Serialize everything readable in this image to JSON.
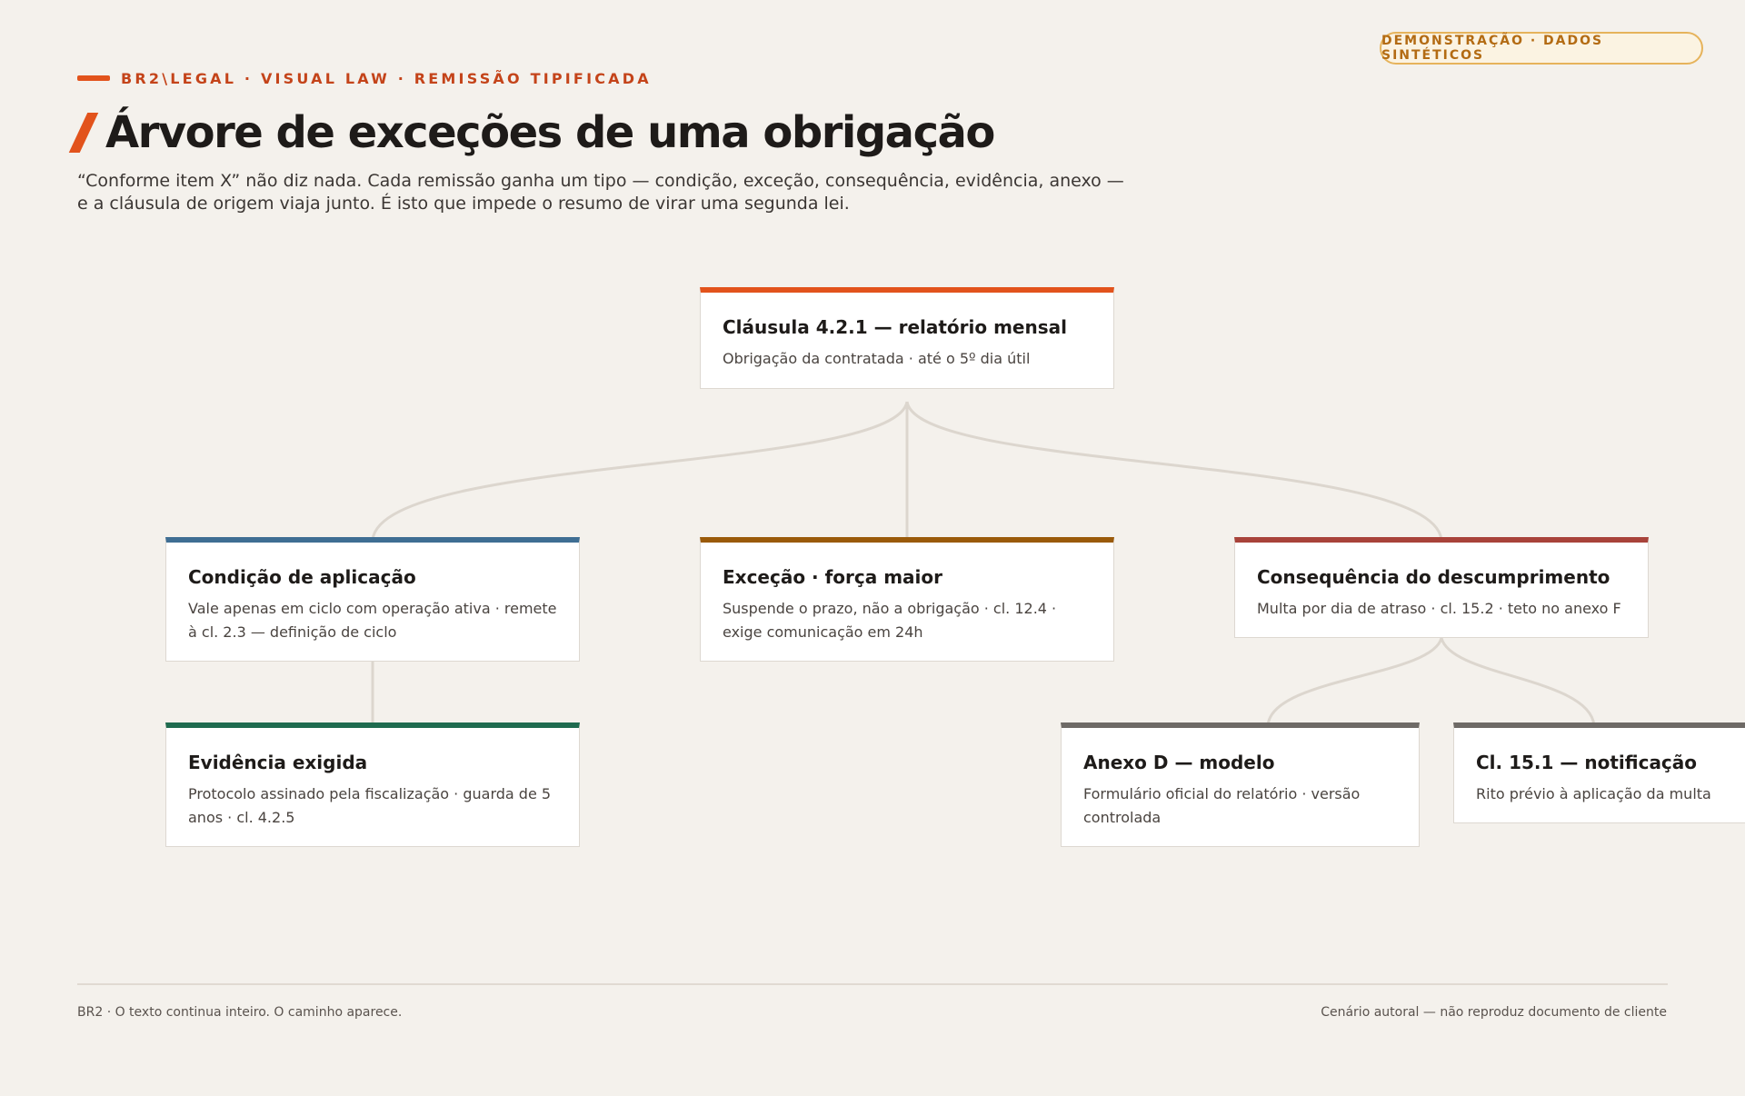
{
  "badge": "DEMONSTRAÇÃO · DADOS SINTÉTICOS",
  "eyebrow": "BR2\\LEGAL · VISUAL LAW · REMISSÃO TIPIFICADA",
  "title": "Árvore de exceções de uma obrigação",
  "subtitle": "“Conforme item X” não diz nada. Cada remissão ganha um tipo — condição, exceção, consequência, evidência, anexo — e a cláusula de origem viaja junto. É isto que impede o resumo de virar uma segunda lei.",
  "colors": {
    "accent": "#e2531c",
    "condicao": "#3f6e93",
    "excecao": "#9a5a0a",
    "consequencia": "#a8433a",
    "evidencia": "#1f6b4f",
    "anexo": "#6e6a66",
    "link": "#dcd6ce"
  },
  "nodes": {
    "root": {
      "title": "Cláusula 4.2.1 — relatório mensal",
      "desc": "Obrigação da contratada · até o 5º dia útil"
    },
    "condicao": {
      "title": "Condição de aplicação",
      "desc": "Vale apenas em ciclo com operação ativa · remete à cl. 2.3 — definição de ciclo"
    },
    "excecao": {
      "title": "Exceção · força maior",
      "desc": "Suspende o prazo, não a obrigação · cl. 12.4 · exige comunicação em 24h"
    },
    "consequencia": {
      "title": "Consequência do descumprimento",
      "desc": "Multa por dia de atraso · cl. 15.2 · teto no anexo F"
    },
    "evidencia": {
      "title": "Evidência exigida",
      "desc": "Protocolo assinado pela fiscalização · guarda de 5 anos · cl. 4.2.5"
    },
    "anexo": {
      "title": "Anexo D — modelo",
      "desc": "Formulário oficial do relatório · versão controlada"
    },
    "notificacao": {
      "title": "Cl. 15.1 — notificação",
      "desc": "Rito prévio à aplicação da multa"
    }
  },
  "footer": {
    "left": "BR2 · O texto continua inteiro. O caminho aparece.",
    "right": "Cenário autoral — não reproduz documento de cliente"
  }
}
